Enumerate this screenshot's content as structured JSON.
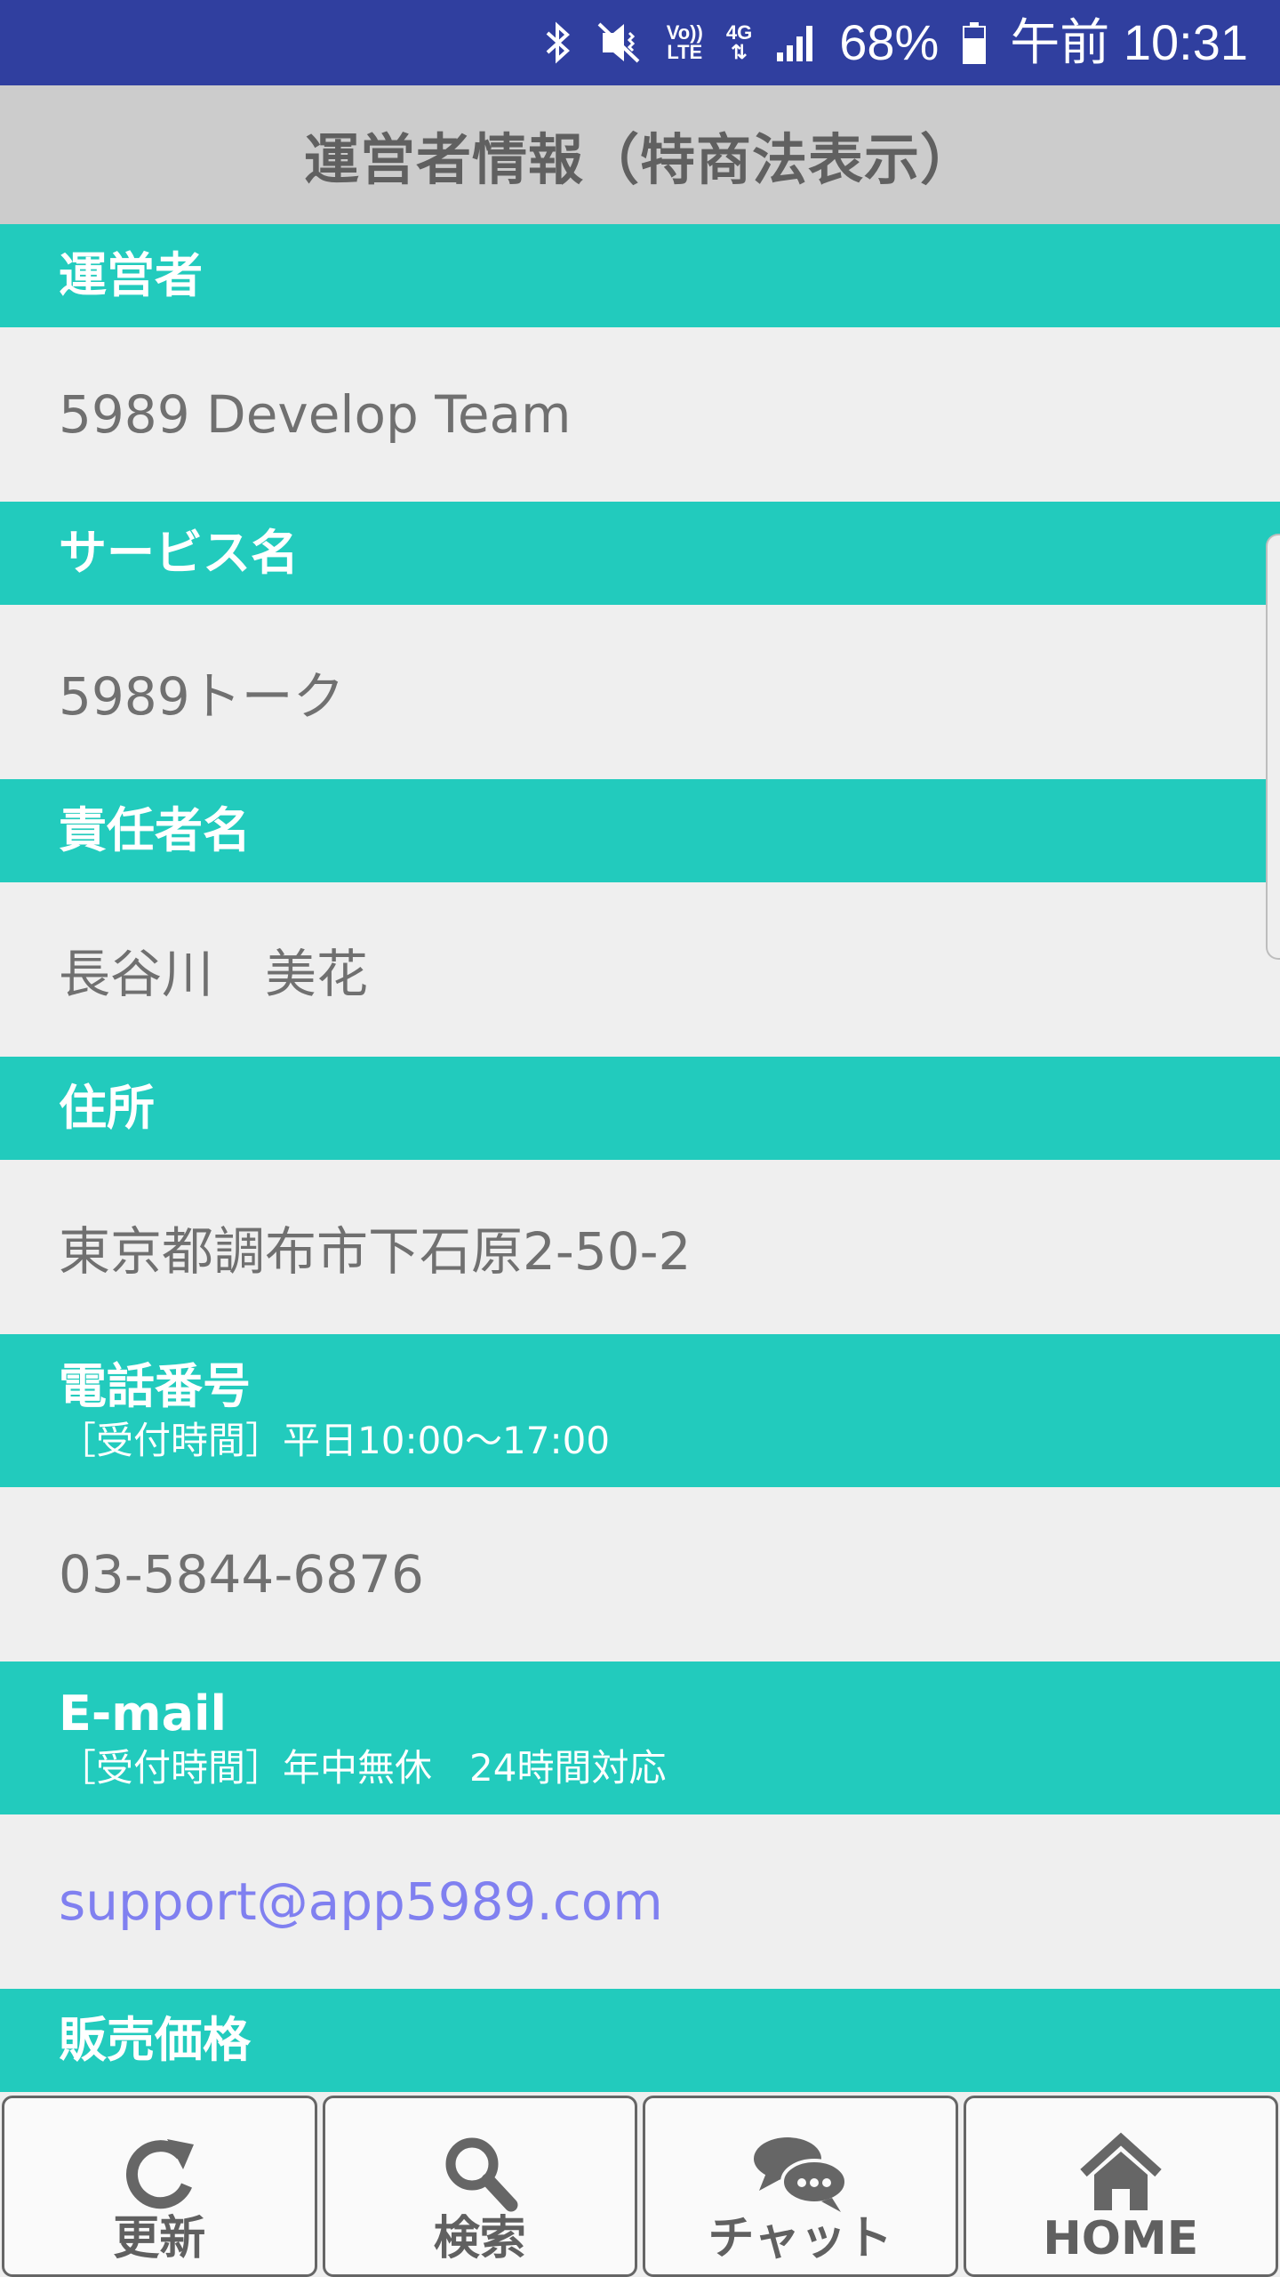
{
  "status_bar": {
    "network_top": "Vo))",
    "network_bottom": "LTE",
    "signal_gen": "4G",
    "battery": "68%",
    "time": "午前 10:31"
  },
  "title": "運営者情報（特商法表示）",
  "sections": [
    {
      "label": "運営者",
      "sub": "",
      "value": "5989 Develop Team"
    },
    {
      "label": "サービス名",
      "sub": "",
      "value": "5989トーク"
    },
    {
      "label": "責任者名",
      "sub": "",
      "value": "長谷川　美花"
    },
    {
      "label": "住所",
      "sub": "",
      "value": "東京都調布市下石原2-50-2"
    },
    {
      "label": "電話番号",
      "sub": "［受付時間］平日10:00〜17:00",
      "value": "03-5844-6876"
    },
    {
      "label": "E-mail",
      "sub": "［受付時間］年中無休　24時間対応",
      "value": "support@app5989.com"
    },
    {
      "label": "販売価格",
      "sub": "",
      "value": ""
    }
  ],
  "bottom_nav": [
    {
      "label": "更新",
      "icon": "refresh-icon"
    },
    {
      "label": "検索",
      "icon": "search-icon"
    },
    {
      "label": "チャット",
      "icon": "chat-icon"
    },
    {
      "label": "HOME",
      "icon": "home-icon"
    }
  ],
  "colors": {
    "status_bar": "#303f9f",
    "title_bar": "#cccccc",
    "section_header": "#22cbbd",
    "link": "#8080f0",
    "value_text": "#707070"
  }
}
